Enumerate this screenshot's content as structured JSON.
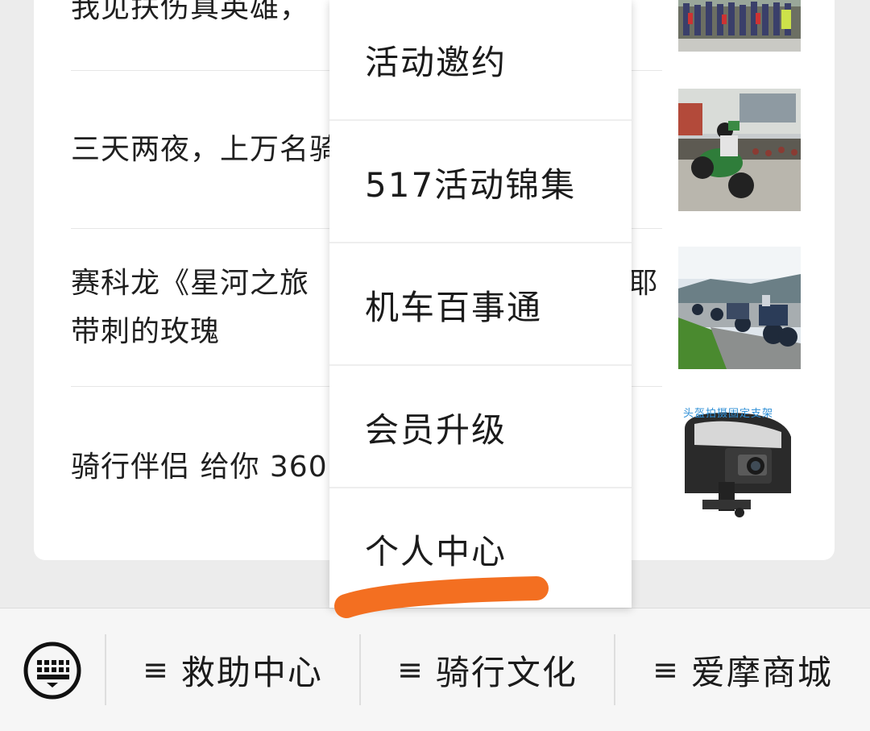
{
  "articles": [
    {
      "title": "我见扶伤真英雄，"
    },
    {
      "title": "三天两夜，上万名骑"
    },
    {
      "title": "赛科龙《星河之旅\n带刺的玫瑰"
    },
    {
      "title": "骑行伴侣 给你 360"
    }
  ],
  "article_right_fragment": "耶",
  "thumb4_caption": "头盔拍摄固定支架",
  "menu": {
    "items": [
      {
        "label": "活动邀约"
      },
      {
        "label": "517活动锦集"
      },
      {
        "label": "机车百事通"
      },
      {
        "label": "会员升级"
      },
      {
        "label": "个人中心"
      }
    ]
  },
  "bottom_bar": {
    "tabs": [
      {
        "icon": "≡",
        "label": "救助中心"
      },
      {
        "icon": "≡",
        "label": "骑行文化"
      },
      {
        "icon": "≡",
        "label": "爱摩商城"
      }
    ]
  },
  "colors": {
    "highlight_stroke": "#f36f21",
    "background": "#ececec",
    "card": "#ffffff"
  }
}
